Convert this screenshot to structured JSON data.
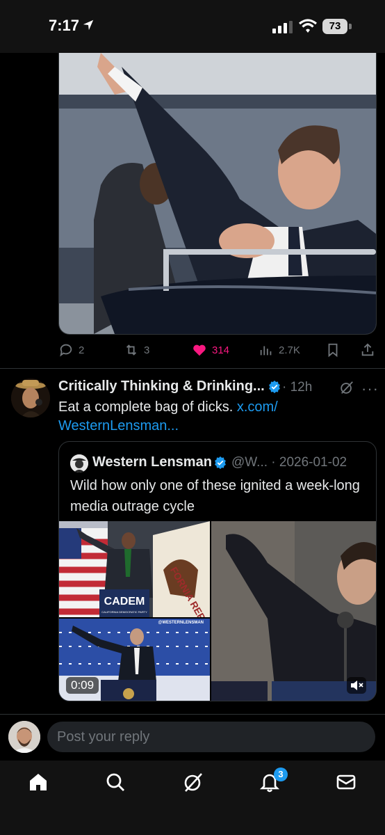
{
  "status_bar": {
    "time": "7:17",
    "battery": "73"
  },
  "tweet1": {
    "actions": {
      "replies": "2",
      "reposts": "3",
      "likes": "314",
      "views": "2.7K"
    }
  },
  "tweet2": {
    "author": "Critically Thinking & Drinking...",
    "time": "· 12h",
    "text": "Eat a complete bag of dicks. ",
    "link_line1": "x.com/",
    "link_line2": "WesternLensman...",
    "quote": {
      "author": "Western Lensman",
      "handle": "@W... · 2026-01-02",
      "text": "Wild how only one of these ignited a week-long media outrage cycle",
      "video_duration": "0:09",
      "sign_text": "CADEM",
      "sign_subtext": "CALIFORNIA DEMOCRATIC PARTY",
      "flag_text": "FORNIA REPUBL",
      "watermark": "@WESTERNLENSMAN"
    }
  },
  "reply": {
    "placeholder": "Post your reply"
  },
  "tabbar": {
    "notifications_count": "3"
  },
  "colors": {
    "accent": "#1d9bf0",
    "like": "#f91880",
    "muted": "#71767b",
    "background": "#000000"
  }
}
